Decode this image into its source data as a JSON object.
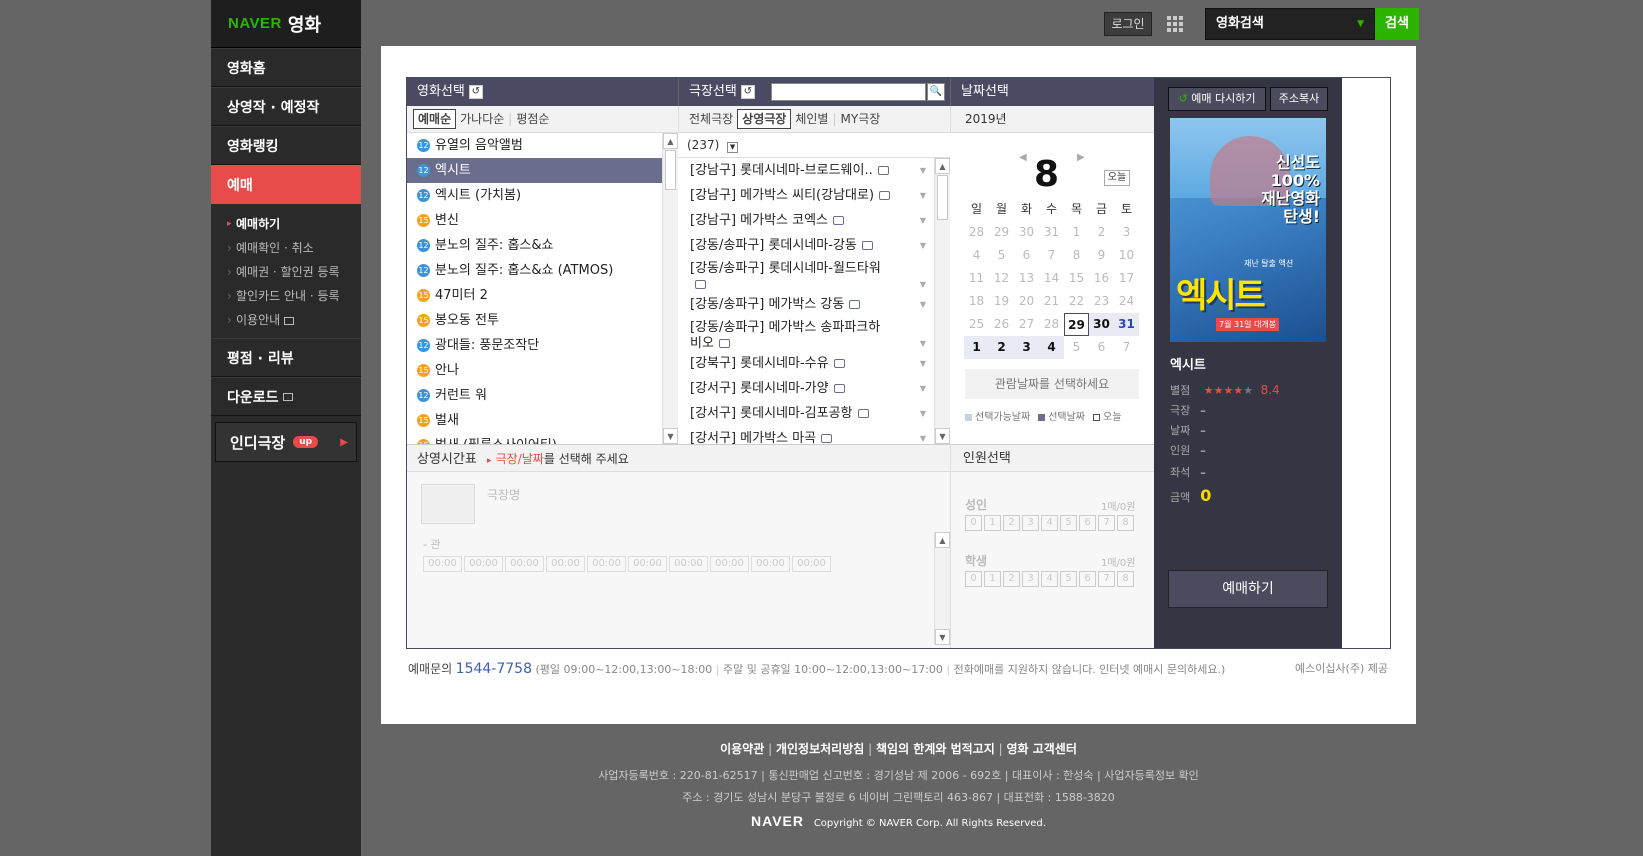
{
  "brand": {
    "naver": "NAVER",
    "movie": "영화"
  },
  "nav": {
    "items": [
      "영화홈",
      "상영작 · 예정작",
      "영화랭킹",
      "예매",
      "평점 · 리뷰",
      "다운로드"
    ],
    "sub": [
      "예매하기",
      "예매확인 · 취소",
      "예매권 · 할인권 등록",
      "할인카드 안내 · 등록",
      "이용안내"
    ],
    "indie": "인디극장",
    "indie_badge": "up"
  },
  "topbar": {
    "login": "로그인",
    "search_select": "영화검색",
    "search_btn": "검색"
  },
  "movie_col": {
    "title": "영화선택",
    "sorts": [
      "예매순",
      "가나다순",
      "평점순"
    ],
    "movies": [
      {
        "age": "12",
        "title": "유열의 음악앨범"
      },
      {
        "age": "12",
        "title": "엑시트"
      },
      {
        "age": "12",
        "title": "엑시트 (가치봄)"
      },
      {
        "age": "15",
        "title": "변신"
      },
      {
        "age": "12",
        "title": "분노의 질주: 홉스&쇼"
      },
      {
        "age": "12",
        "title": "분노의 질주: 홉스&쇼 (ATMOS)"
      },
      {
        "age": "15",
        "title": "47미터 2"
      },
      {
        "age": "15",
        "title": "봉오동 전투"
      },
      {
        "age": "12",
        "title": "광대들: 풍문조작단"
      },
      {
        "age": "15",
        "title": "안나"
      },
      {
        "age": "12",
        "title": "커런트 워"
      },
      {
        "age": "15",
        "title": "벌새"
      },
      {
        "age": "15",
        "title": "벌새 (필름소사이어티)"
      }
    ]
  },
  "theater_col": {
    "title": "극장선택",
    "tabs": [
      "전체극장",
      "상영극장",
      "체인별",
      "MY극장"
    ],
    "count": "(237)",
    "theaters": [
      "[강남구] 롯데시네마-브로드웨이..",
      "[강남구] 메가박스 씨티(강남대로)",
      "[강남구] 메가박스 코엑스",
      "[강동/송파구] 롯데시네마-강동",
      "[강동/송파구] 롯데시네마-월드타워",
      "[강동/송파구] 메가박스 강동",
      "[강동/송파구] 메가박스 송파파크하",
      "[강북구] 롯데시네마-수유",
      "[강서구] 롯데시네마-가양",
      "[강서구] 롯데시네마-김포공항",
      "[강서구] 메가박스 마곡"
    ],
    "wrap_line": "비오"
  },
  "date_col": {
    "title": "날짜선택",
    "year": "2019년",
    "month": "8",
    "today_btn": "오늘",
    "weekdays": [
      "일",
      "월",
      "화",
      "수",
      "목",
      "금",
      "토"
    ],
    "rows": [
      [
        "28",
        "29",
        "30",
        "31",
        "1",
        "2",
        "3"
      ],
      [
        "4",
        "5",
        "6",
        "7",
        "8",
        "9",
        "10"
      ],
      [
        "11",
        "12",
        "13",
        "14",
        "15",
        "16",
        "17"
      ],
      [
        "18",
        "19",
        "20",
        "21",
        "22",
        "23",
        "24"
      ],
      [
        "25",
        "26",
        "27",
        "28",
        "29",
        "30",
        "31"
      ],
      [
        "1",
        "2",
        "3",
        "4",
        "5",
        "6",
        "7"
      ]
    ],
    "prompt": "관람날짜를 선택하세요",
    "legend": [
      "선택가능날짜",
      "선택날짜",
      "오늘"
    ]
  },
  "schedule": {
    "title": "상영시간표",
    "hint_a": "극장/날짜",
    "hint_b": "를 선택해 주세요",
    "theater_name": "극장명",
    "hall": "- 관",
    "times": [
      "00:00",
      "00:00",
      "00:00",
      "00:00",
      "00:00",
      "00:00",
      "00:00",
      "00:00",
      "00:00",
      "00:00"
    ]
  },
  "people": {
    "title": "인원선택",
    "adult": "성인",
    "student": "학생",
    "max": "1매/0원",
    "nums": [
      "0",
      "1",
      "2",
      "3",
      "4",
      "5",
      "6",
      "7",
      "8"
    ]
  },
  "summary": {
    "rebook": "예매 다시하기",
    "copy": "주소복사",
    "movie": "엑시트",
    "rating_label": "별점",
    "rating": "8.4",
    "labels": [
      "극장",
      "날짜",
      "인원",
      "좌석"
    ],
    "dash": "–",
    "price_label": "금액",
    "price": "0",
    "book": "예매하기",
    "poster_text": "신선도 100% 재난영화 탄생!",
    "poster_title": "엑시트",
    "poster_date": "7월 31일 대개봉",
    "poster_tag": "재난 탈출 액션"
  },
  "contact": {
    "label": "예매문의",
    "phone": "1544-7758",
    "hours1": "(평일 09:00~12:00,13:00~18:00",
    "hours2": "주말 및 공휴일 10:00~12:00,13:00~17:00",
    "note": "전화예매를 지원하지 않습니다. 인터넷 예매시 문의하세요.)",
    "provider": "예스이십사(주) 제공"
  },
  "footer": {
    "links": [
      "이용약관",
      "개인정보처리방침",
      "책임의 한계와 법적고지",
      "영화 고객센터"
    ],
    "line1": "사업자등록번호 : 220-81-62517  |  통신판매업 신고번호 : 경기성남 제 2006 - 692호  |  대표이사 : 한성숙  |  사업자등록정보 확인",
    "line2": "주소 : 경기도 성남시 분당구 불정로 6 네이버 그린팩토리 463-867  |  대표전화 : 1588-3820",
    "logo": "NAVER",
    "copyright": "Copyright © NAVER Corp.  All Rights Reserved."
  },
  "colors": {
    "accent": "#2db400",
    "active": "#e94b4b",
    "header": "#4a4b63",
    "star": "#e94b4b",
    "price": "#ffd800"
  }
}
